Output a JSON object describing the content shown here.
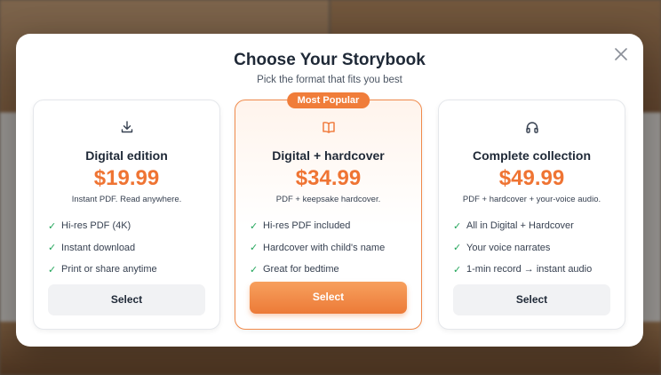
{
  "modal": {
    "title": "Choose Your Storybook",
    "subtitle": "Pick the format that fits you best",
    "close_icon": "close-icon"
  },
  "plans": [
    {
      "icon": "download-icon",
      "name": "Digital edition",
      "price": "$19.99",
      "description": "Instant PDF. Read anywhere.",
      "features": [
        "Hi-res PDF (4K)",
        "Instant download",
        "Print or share anytime"
      ],
      "button_label": "Select",
      "highlighted": false
    },
    {
      "badge": "Most Popular",
      "icon": "book-open-icon",
      "name": "Digital + hardcover",
      "price": "$34.99",
      "description": "PDF + keepsake hardcover.",
      "features": [
        "Hi-res PDF included",
        "Hardcover with child's name",
        "Great for bedtime"
      ],
      "button_label": "Select",
      "highlighted": true
    },
    {
      "icon": "headphones-icon",
      "name": "Complete collection",
      "price": "$49.99",
      "description": "PDF + hardcover + your-voice audio.",
      "features": [
        "All in Digital + Hardcover",
        "Your voice narrates",
        "1-min record → instant audio"
      ],
      "button_label": "Select",
      "highlighted": false
    }
  ],
  "colors": {
    "accent": "#ef7433",
    "check": "#22a55a",
    "badge_bg": "#f07d3a"
  }
}
